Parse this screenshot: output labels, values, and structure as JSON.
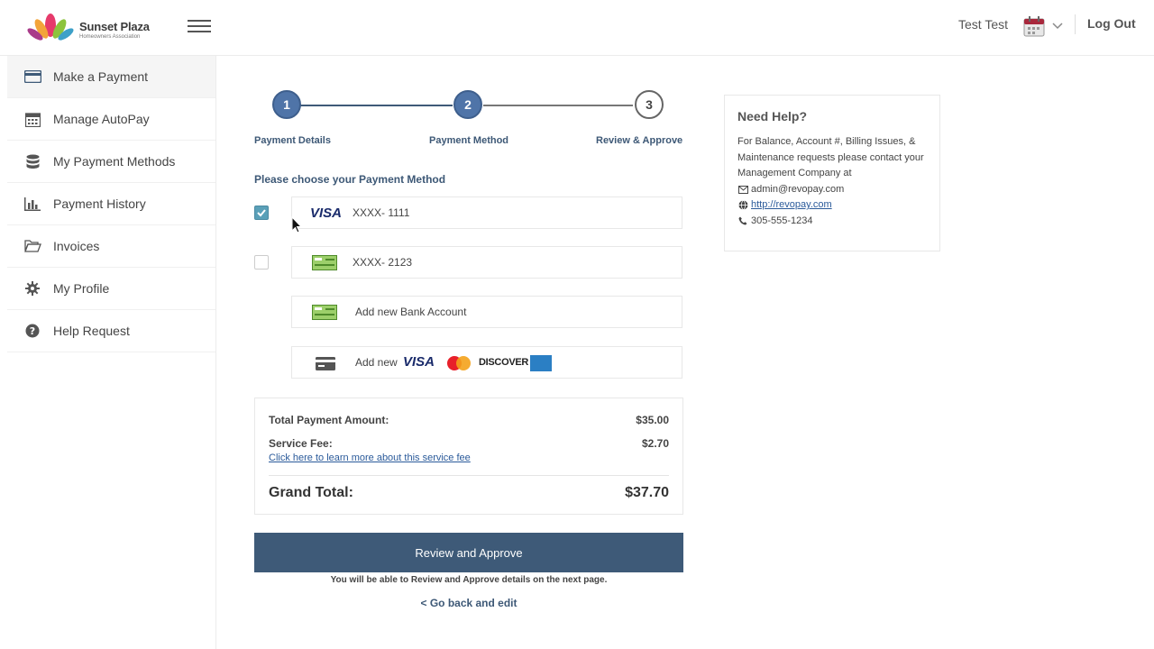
{
  "header": {
    "brand_name": "Sunset Plaza",
    "brand_sub": "Homeowners Association",
    "user_name": "Test Test",
    "logout_label": "Log Out"
  },
  "sidebar": {
    "items": [
      {
        "label": "Make a Payment",
        "icon": "credit-card-icon",
        "active": true
      },
      {
        "label": "Manage AutoPay",
        "icon": "calendar-icon"
      },
      {
        "label": "My Payment Methods",
        "icon": "database-icon"
      },
      {
        "label": "Payment History",
        "icon": "bar-chart-icon"
      },
      {
        "label": "Invoices",
        "icon": "folder-open-icon"
      },
      {
        "label": "My Profile",
        "icon": "gear-icon"
      },
      {
        "label": "Help Request",
        "icon": "question-circle-icon"
      }
    ]
  },
  "stepper": {
    "steps": [
      {
        "number": "1",
        "label": "Payment Details",
        "state": "done"
      },
      {
        "number": "2",
        "label": "Payment Method",
        "state": "done"
      },
      {
        "number": "3",
        "label": "Review & Approve",
        "state": "todo"
      }
    ]
  },
  "payment": {
    "title": "Please choose your Payment Method",
    "methods": [
      {
        "type": "visa",
        "icon_label": "VISA",
        "text": "XXXX- 1111",
        "checked": true
      },
      {
        "type": "bank",
        "icon_label": "eCheck",
        "text": "XXXX- 2123",
        "checked": false
      }
    ],
    "add_bank_label": "Add new Bank Account",
    "add_card_label": "Add new",
    "card_brands": {
      "visa": "VISA",
      "mastercard": "MasterCard",
      "discover": "DISCOVER",
      "amex": "AMEX"
    }
  },
  "totals": {
    "total_label": "Total Payment Amount:",
    "total_value": "$35.00",
    "fee_label": "Service Fee:",
    "fee_value": "$2.70",
    "fee_link": "Click here to learn more about this service fee",
    "grand_label": "Grand Total:",
    "grand_value": "$37.70"
  },
  "actions": {
    "review_label": "Review and Approve",
    "review_note": "You will be able to Review and Approve details on the next page.",
    "go_back_label": "< Go back and edit"
  },
  "help": {
    "title": "Need Help?",
    "description": "For Balance, Account #, Billing Issues, & Maintenance requests please contact your Management Company at",
    "email": "admin@revopay.com",
    "website": "http://revopay.com",
    "phone": "305-555-1234"
  },
  "colors": {
    "primary": "#3e5a78",
    "step_done": "#4f74a8",
    "check": "#5aa0b8",
    "link": "#2a5a9a"
  }
}
